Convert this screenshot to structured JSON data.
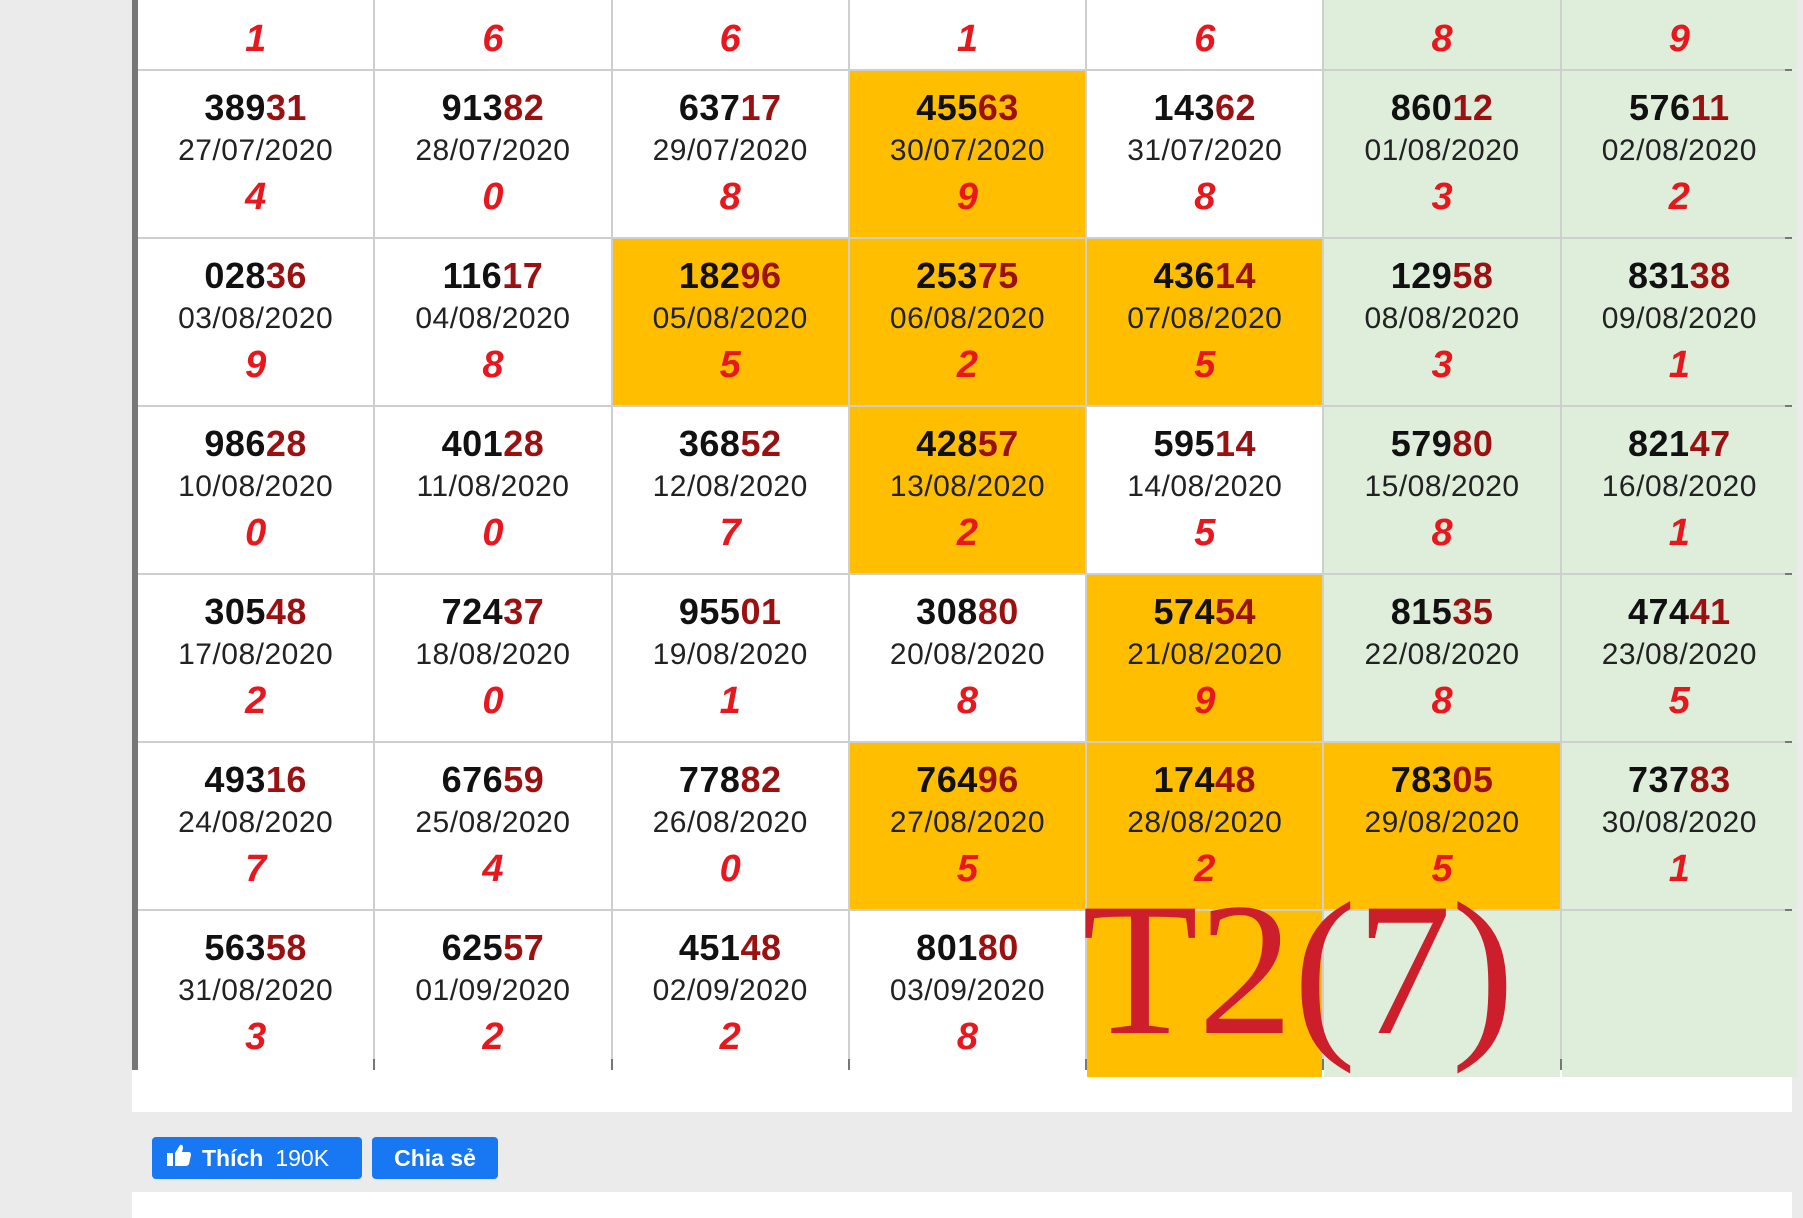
{
  "header_sums": [
    "1",
    "6",
    "6",
    "1",
    "6",
    "8",
    "9"
  ],
  "rows": [
    [
      {
        "head": "389",
        "tail": "31",
        "date": "27/07/2020",
        "sum": "4"
      },
      {
        "head": "913",
        "tail": "82",
        "date": "28/07/2020",
        "sum": "0"
      },
      {
        "head": "637",
        "tail": "17",
        "date": "29/07/2020",
        "sum": "8"
      },
      {
        "head": "455",
        "tail": "63",
        "date": "30/07/2020",
        "sum": "9",
        "highlight": true
      },
      {
        "head": "143",
        "tail": "62",
        "date": "31/07/2020",
        "sum": "8"
      },
      {
        "head": "860",
        "tail": "12",
        "date": "01/08/2020",
        "sum": "3"
      },
      {
        "head": "576",
        "tail": "11",
        "date": "02/08/2020",
        "sum": "2"
      }
    ],
    [
      {
        "head": "028",
        "tail": "36",
        "date": "03/08/2020",
        "sum": "9"
      },
      {
        "head": "116",
        "tail": "17",
        "date": "04/08/2020",
        "sum": "8"
      },
      {
        "head": "182",
        "tail": "96",
        "date": "05/08/2020",
        "sum": "5",
        "highlight": true
      },
      {
        "head": "253",
        "tail": "75",
        "date": "06/08/2020",
        "sum": "2",
        "highlight": true
      },
      {
        "head": "436",
        "tail": "14",
        "date": "07/08/2020",
        "sum": "5",
        "highlight": true
      },
      {
        "head": "129",
        "tail": "58",
        "date": "08/08/2020",
        "sum": "3"
      },
      {
        "head": "831",
        "tail": "38",
        "date": "09/08/2020",
        "sum": "1"
      }
    ],
    [
      {
        "head": "986",
        "tail": "28",
        "date": "10/08/2020",
        "sum": "0"
      },
      {
        "head": "401",
        "tail": "28",
        "date": "11/08/2020",
        "sum": "0"
      },
      {
        "head": "368",
        "tail": "52",
        "date": "12/08/2020",
        "sum": "7"
      },
      {
        "head": "428",
        "tail": "57",
        "date": "13/08/2020",
        "sum": "2",
        "highlight": true
      },
      {
        "head": "595",
        "tail": "14",
        "date": "14/08/2020",
        "sum": "5"
      },
      {
        "head": "579",
        "tail": "80",
        "date": "15/08/2020",
        "sum": "8"
      },
      {
        "head": "821",
        "tail": "47",
        "date": "16/08/2020",
        "sum": "1"
      }
    ],
    [
      {
        "head": "305",
        "tail": "48",
        "date": "17/08/2020",
        "sum": "2"
      },
      {
        "head": "724",
        "tail": "37",
        "date": "18/08/2020",
        "sum": "0"
      },
      {
        "head": "955",
        "tail": "01",
        "date": "19/08/2020",
        "sum": "1"
      },
      {
        "head": "308",
        "tail": "80",
        "date": "20/08/2020",
        "sum": "8"
      },
      {
        "head": "574",
        "tail": "54",
        "date": "21/08/2020",
        "sum": "9",
        "highlight": true
      },
      {
        "head": "815",
        "tail": "35",
        "date": "22/08/2020",
        "sum": "8"
      },
      {
        "head": "474",
        "tail": "41",
        "date": "23/08/2020",
        "sum": "5"
      }
    ],
    [
      {
        "head": "493",
        "tail": "16",
        "date": "24/08/2020",
        "sum": "7"
      },
      {
        "head": "676",
        "tail": "59",
        "date": "25/08/2020",
        "sum": "4"
      },
      {
        "head": "778",
        "tail": "82",
        "date": "26/08/2020",
        "sum": "0"
      },
      {
        "head": "764",
        "tail": "96",
        "date": "27/08/2020",
        "sum": "5",
        "highlight": true
      },
      {
        "head": "174",
        "tail": "48",
        "date": "28/08/2020",
        "sum": "2",
        "highlight": true
      },
      {
        "head": "783",
        "tail": "05",
        "date": "29/08/2020",
        "sum": "5",
        "highlight": true
      },
      {
        "head": "737",
        "tail": "83",
        "date": "30/08/2020",
        "sum": "1"
      }
    ],
    [
      {
        "head": "563",
        "tail": "58",
        "date": "31/08/2020",
        "sum": "3"
      },
      {
        "head": "625",
        "tail": "57",
        "date": "01/09/2020",
        "sum": "2"
      },
      {
        "head": "451",
        "tail": "48",
        "date": "02/09/2020",
        "sum": "2"
      },
      {
        "head": "801",
        "tail": "80",
        "date": "03/09/2020",
        "sum": "8"
      },
      {
        "empty": true,
        "highlight": true
      },
      {
        "empty": true
      },
      {
        "empty": true
      }
    ]
  ],
  "overlay": "T2(7)",
  "social": {
    "like_label": "Thích",
    "like_count": "190K",
    "share_label": "Chia sẻ",
    "icon": "thumbs-up-icon"
  },
  "colors": {
    "highlight": "#ffbf00",
    "weekend": "#deeedb",
    "sum_red": "#e8161d",
    "tail_dark_red": "#9b1111",
    "overlay_red": "#cc1e2b",
    "facebook_blue": "#1877f2"
  }
}
